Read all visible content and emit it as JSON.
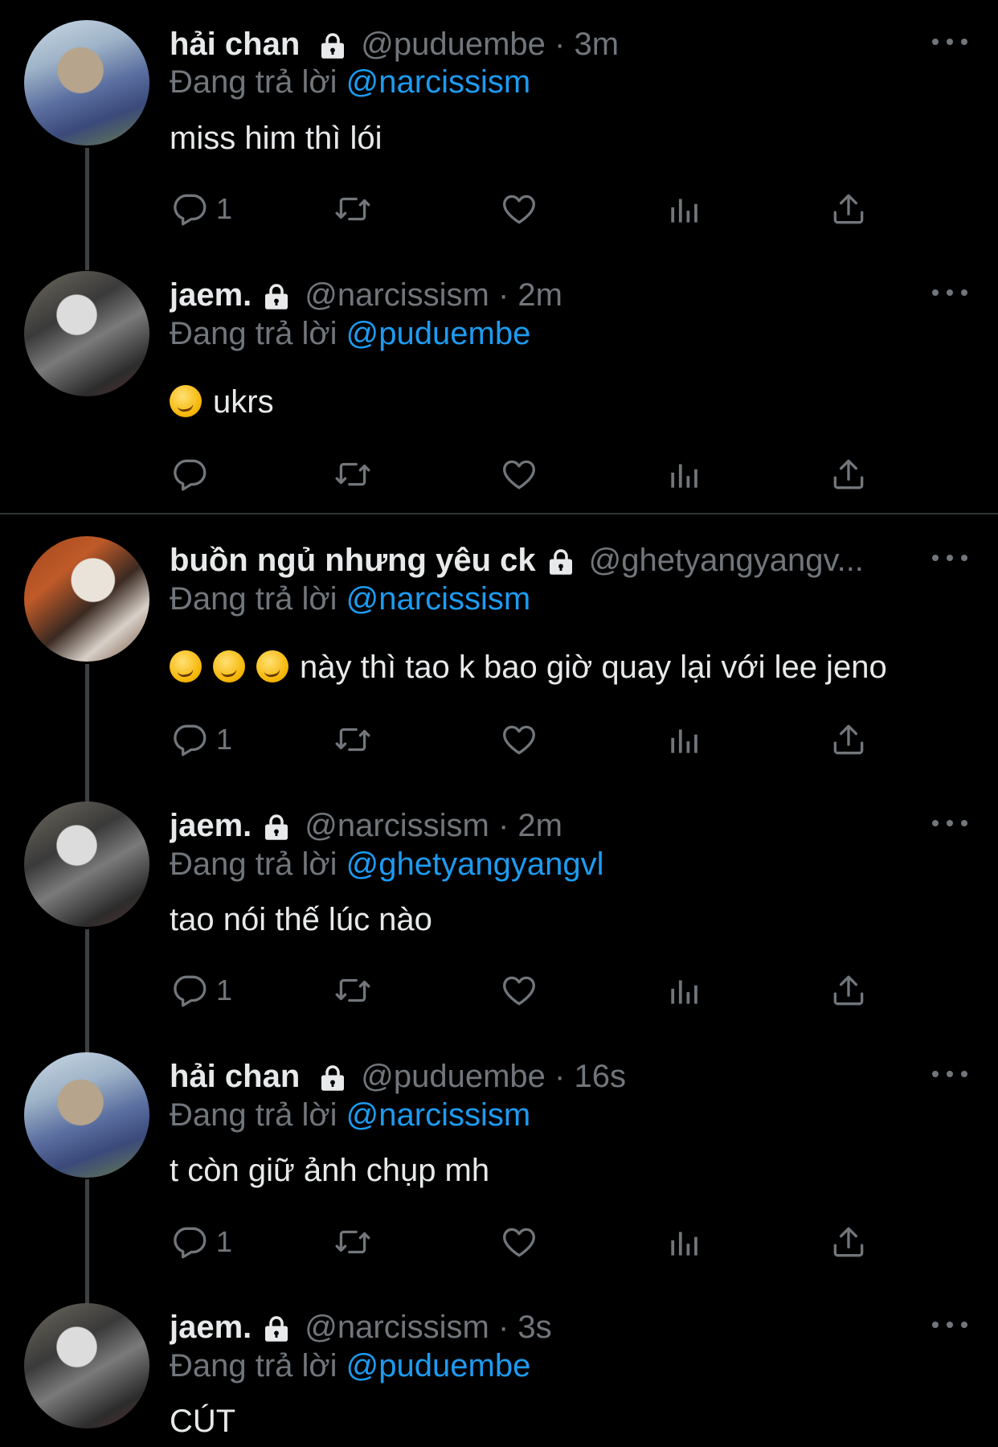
{
  "theme": {
    "background": "#000000",
    "text": "#e7e9ea",
    "muted": "#71767b",
    "accent": "#1d9bf0"
  },
  "reply_prefix": "Đang trả lời",
  "tweets": [
    {
      "name": "hải chan",
      "handle": "@puduembe",
      "time": "· 3m",
      "reply_to": "@narcissism",
      "text": "miss him thì lói",
      "reply_count": "1",
      "avatar": "hai-chan"
    },
    {
      "name": "jaem.",
      "handle": "@narcissism",
      "time": "· 2m",
      "reply_to": "@puduembe",
      "text": "ukrs",
      "emojis": [
        "smirk"
      ],
      "reply_count": "",
      "avatar": "jaem"
    },
    {
      "name": "buồn ngủ nhưng yêu ck",
      "handle": "@ghetyangyangv...",
      "time": "",
      "reply_to": "@narcissism",
      "text": "này thì tao k bao giờ quay lại với lee jeno",
      "emojis": [
        "smirk",
        "smirk",
        "smirk"
      ],
      "reply_count": "1",
      "avatar": "buon-ngu"
    },
    {
      "name": "jaem.",
      "handle": "@narcissism",
      "time": "· 2m",
      "reply_to": "@ghetyangyangvl",
      "text": "tao nói thế lúc nào",
      "reply_count": "1",
      "avatar": "jaem"
    },
    {
      "name": "hải chan",
      "handle": "@puduembe",
      "time": "· 16s",
      "reply_to": "@narcissism",
      "text": "t còn giữ ảnh chụp mh",
      "reply_count": "1",
      "avatar": "hai-chan"
    },
    {
      "name": "jaem.",
      "handle": "@narcissism",
      "time": "· 3s",
      "reply_to": "@puduembe",
      "text": "CÚT",
      "reply_count": "",
      "avatar": "jaem"
    }
  ],
  "icons": {
    "reply": "reply-icon",
    "retweet": "retweet-icon",
    "like": "heart-icon",
    "views": "views-icon",
    "share": "share-icon",
    "more": "more-icon",
    "lock": "lock-icon"
  }
}
